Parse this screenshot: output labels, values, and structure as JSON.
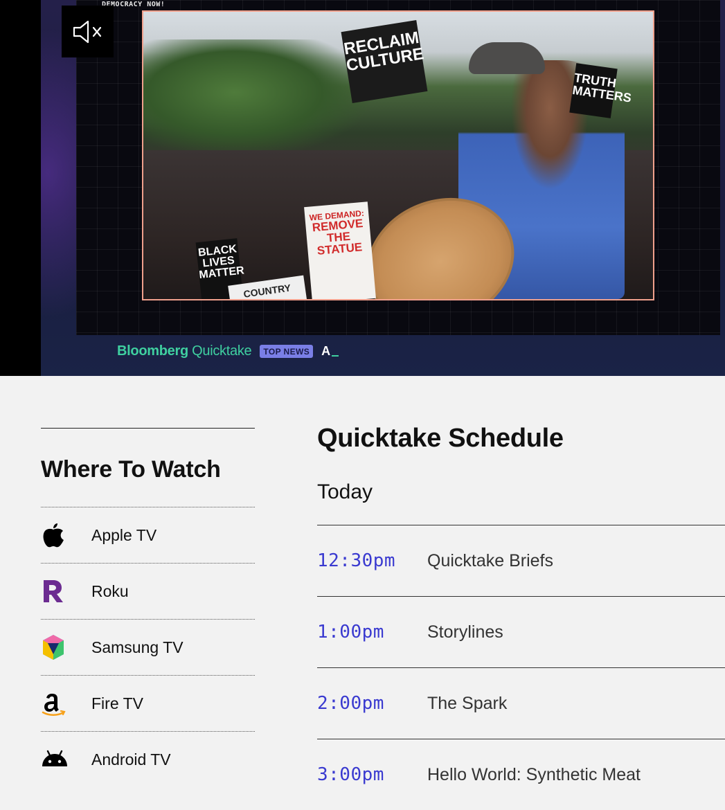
{
  "video": {
    "source_label": "DEMOCRACY NOW!",
    "mute_icon": "muted-speaker-icon",
    "frame_signs": {
      "reclaim": "RECLAIM CULTURE",
      "demand": "WE DEMAND:",
      "remove": "REMOVE THE STATUE",
      "blm": "BLACK LIVES MATTER",
      "truth": "TRUTH MATTERS",
      "country": "COUNTRY"
    },
    "brand": "Bloomberg",
    "brand_sub": "Quicktake",
    "badge": "TOP NEWS",
    "ticker": "A",
    "colors": {
      "brand": "#3fd0a0",
      "badge_bg": "#7a7fe6",
      "frame_border": "#f0a08c"
    }
  },
  "where_to_watch": {
    "title": "Where To Watch",
    "items": [
      {
        "label": "Apple TV",
        "icon": "apple-icon"
      },
      {
        "label": "Roku",
        "icon": "roku-icon"
      },
      {
        "label": "Samsung TV",
        "icon": "samsung-tv-icon"
      },
      {
        "label": "Fire TV",
        "icon": "amazon-icon"
      },
      {
        "label": "Android TV",
        "icon": "android-icon"
      }
    ]
  },
  "schedule": {
    "title": "Quicktake Schedule",
    "day": "Today",
    "time_color": "#3a3ad0",
    "items": [
      {
        "time": "12:30pm",
        "show": "Quicktake Briefs"
      },
      {
        "time": "1:00pm",
        "show": "Storylines"
      },
      {
        "time": "2:00pm",
        "show": "The Spark"
      },
      {
        "time": "3:00pm",
        "show": "Hello World: Synthetic Meat"
      }
    ]
  }
}
